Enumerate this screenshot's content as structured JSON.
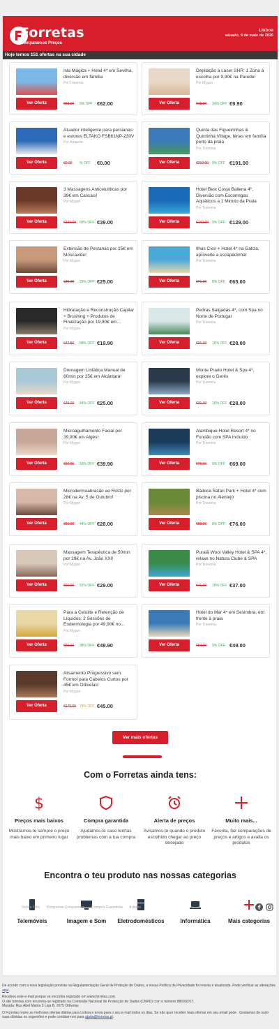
{
  "header": {
    "brand": "Forretas",
    "tagline": "Comparamos Preços",
    "city": "Lisboa",
    "date": "sábado, 9 de maio de 2026"
  },
  "offers_bar": "Hoje temos 151 ofertas na sua cidade",
  "button_label": "Ver Oferta",
  "offers": [
    {
      "title": "Isla Mágica + Hotel 4* em Sevilha, diversão em família",
      "vendor": "Por:Travenia",
      "old_price": "€68.00",
      "discount": "9% OFF",
      "price": "€62.00"
    },
    {
      "title": "Depilação a Laser SHR: 1 Zona à escolha por 9,90€ na Parede!",
      "vendor": "Por:Mygon",
      "old_price": "€15.00",
      "discount": "34% OFF",
      "price": "€9.90"
    },
    {
      "title": "Atuador inteligente para persianas e estores ELTAKO FSB61NP-230V",
      "vendor": "Por:Amazon",
      "old_price": "€0.00",
      "discount": "% OFF",
      "price": "€0.00"
    },
    {
      "title": "Quinta das Figueirinhas & Quintinha Village, férias em família perto da praia",
      "vendor": "Por:Travenia",
      "old_price": "€210.00",
      "discount": "9% OFF",
      "price": "€191.00"
    },
    {
      "title": "3 Massagens Anticelulíticas por 39€ em Cascais!",
      "vendor": "Por:Mygon",
      "old_price": "€120.00",
      "discount": "68% OFF",
      "price": "€39.00"
    },
    {
      "title": "Hotel Best Costa Ballena 4*, Diversão com Escorregas Aquáticos a 1 Minuto da Praia",
      "vendor": "Por:Travenia",
      "old_price": "€142.00",
      "discount": "9% OFF",
      "price": "€129.00"
    },
    {
      "title": "Extensão de Pestanas por 25€ em Moscavide!",
      "vendor": "Por:Mygon",
      "old_price": "€35.00",
      "discount": "29% OFF",
      "price": "€25.00"
    },
    {
      "title": "Ilhas Cíes + Hotel 4* na Galiza, aproveite a escapadinha!",
      "vendor": "Por:Travenia",
      "old_price": "€71.00",
      "discount": "8% OFF",
      "price": "€65.00"
    },
    {
      "title": "Hidratação e Reconstrução Capilar + Brushing + Produtos de Finalização por 19,90€ em...",
      "vendor": "Por:Mygon",
      "old_price": "€47.50",
      "discount": "58% OFF",
      "price": "€19.90"
    },
    {
      "title": "Pedras Salgadas 4*, com Spa no Norte de Portugal",
      "vendor": "Por:Travenia",
      "old_price": "€31.00",
      "discount": "10% OFF",
      "price": "€28.00"
    },
    {
      "title": "Drenagem Linfática Manual de 60min por 25€ em Alcântara!",
      "vendor": "Por:Mygon",
      "old_price": "€45.00",
      "discount": "44% OFF",
      "price": "€25.00"
    },
    {
      "title": "Monte Prado Hotel & Spa 4*, explore o Gerês",
      "vendor": "Por:Travenia",
      "old_price": "€31.00",
      "discount": "10% OFF",
      "price": "€28.00"
    },
    {
      "title": "Microagulhamento Facial por 39,90€ em Algés!",
      "vendor": "Por:Mygon",
      "old_price": "€60.00",
      "discount": "33% OFF",
      "price": "€39.90"
    },
    {
      "title": "Alambique Hotel Resort 4* no Fundão com SPA incluído",
      "vendor": "Por:Travenia",
      "old_price": "€76.00",
      "discount": "9% OFF",
      "price": "€69.00"
    },
    {
      "title": "Microdermoabrasão ao Rosto por 28€ na Av. 5 de Outubro!",
      "vendor": "Por:Mygon",
      "old_price": "€50.00",
      "discount": "44% OFF",
      "price": "€28.00"
    },
    {
      "title": "Badoca Safari Park + Hotel 4* com piscina no Alentejo",
      "vendor": "Por:Travenia",
      "old_price": "€83.00",
      "discount": "8% OFF",
      "price": "€76.00"
    },
    {
      "title": "Massagem Terapêutica de 50min por 29€ na Av. João XXI!",
      "vendor": "Por:Mygon",
      "old_price": "€60.00",
      "discount": "52% OFF",
      "price": "€29.00"
    },
    {
      "title": "Puralã Wool Valley Hotel & SPA 4*, relaxe no Natura Clube & SPA",
      "vendor": "Por:Travenia",
      "old_price": "€41.00",
      "discount": "10% OFF",
      "price": "€37.00"
    },
    {
      "title": "Para a Celulite e Retenção de Líquidos: 2 Sessões de Endermologia por 49,90€ no...",
      "vendor": "Por:Mygon",
      "old_price": "€80.00",
      "discount": "38% OFF",
      "price": "€49.90"
    },
    {
      "title": "Hotel do Mar 4* em Sesimbra, em frente à praia",
      "vendor": "Por:Travenia",
      "old_price": "€54.00",
      "discount": "9% OFF",
      "price": "€49.00"
    },
    {
      "title": "Alisamento Progressivo sem Formol para Cabelos Curtos por 45€ em Odivelas!",
      "vendor": "Por:Mygon",
      "old_price": "€170.00",
      "discount": "74% OFF",
      "price": "€45.00"
    }
  ],
  "more_button": "Ver mais ofertas",
  "features_title": "Com o Forretas ainda tens:",
  "features": [
    {
      "title": "Preços mais baixos",
      "desc": "Mostramos-te sempre o preço mais baixo em primeiro lugar",
      "icon": "dollar-icon"
    },
    {
      "title": "Compra garantida",
      "desc": "Ajudamos-te caso tenhas problemas com a tua compra",
      "icon": "shield-icon"
    },
    {
      "title": "Alerta de preços",
      "desc": "Avisamos-te quando o produto escolhido chegar ao preço desejado",
      "icon": "alarm-clock-icon"
    },
    {
      "title": "Muito mais...",
      "desc": "Favorita, faz comparações de preços e artigos e avalia os produtos",
      "icon": "plus-icon"
    }
  ],
  "categories_title": "Encontra o teu produto nas nossas categorias",
  "categories": [
    {
      "label": "Telemóveis",
      "icon": "phone-icon"
    },
    {
      "label": "Imagem e Som",
      "icon": "monitor-icon"
    },
    {
      "label": "Eletrodomésticos",
      "icon": "fridge-icon"
    },
    {
      "label": "Informática",
      "icon": "laptop-icon"
    },
    {
      "label": "Mais categorias",
      "icon": "plus-icon"
    }
  ],
  "footer_links": [
    "Sobre Nós",
    "Perguntas Frequentes",
    "Compra Garantida",
    "Artigos"
  ],
  "legal": {
    "p1": "De acordo com a nova legislação prevista na Regulamentação Geral de Proteção de Dados, a nossa Política de Privacidade foi revista e atualizada. Pode verificar as alterações",
    "p1_link": "aqui",
    "p2a": "Recebeu este e-mail porque se encontra registado em www.forretas.com.",
    "p2b": "O site forretas.com encontra-se registado na Comissão Nacional de Protecção de Dados (CNPD) com o número 8869/2017.",
    "p2c": "Morada: Rua Abel Manta 3 Loja B, 2675 Odivelas",
    "p3": "O Forretas reúne as melhores ofertas diárias para Lisboa e envia para o seu e-mail todos os dias. Se não quer receber mais ofertas em seu email pode . Gostamos de ouvir suas dúvidas ou sugestões e pode contatar-nos para",
    "p3_link": "ajuda@forretas.pt"
  },
  "colors": {
    "brand": "#d81e2a",
    "discount": "#3aa85a",
    "bar": "#3a3a3a"
  }
}
